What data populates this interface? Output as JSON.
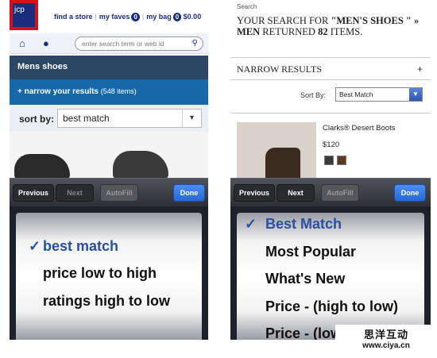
{
  "left": {
    "logo_text": "jcp",
    "links": {
      "find_store": "find a store",
      "faves_label": "my faves",
      "faves_count": "0",
      "bag_label": "my bag",
      "bag_count": "0",
      "bag_total": "$0.00"
    },
    "search": {
      "placeholder": "enter search term or web id"
    },
    "category_title": "Mens shoes",
    "narrow": {
      "label": "+ narrow your results",
      "count": "(548 items)"
    },
    "sort": {
      "label": "sort by:",
      "value": "best match"
    },
    "keyboard": {
      "previous": "Previous",
      "next": "Next",
      "autofill": "AutoFill",
      "done": "Done"
    },
    "picker_options": [
      "best match",
      "price low to high",
      "ratings high to low"
    ],
    "picker_selected_index": 0
  },
  "right": {
    "breadcrumb": "Search",
    "heading_prefix": "YOUR SEARCH FOR ",
    "heading_query": "\"MEN'S SHOES \" » MEN",
    "heading_mid": " RETURNED ",
    "heading_count": "82",
    "heading_suffix": " ITEMS.",
    "narrow_label": "NARROW RESULTS",
    "narrow_plus": "+",
    "sort": {
      "label": "Sort By:",
      "value": "Best Match"
    },
    "product": {
      "name": "Clarks® Desert Boots",
      "price": "$120",
      "swatch_colors": [
        "#3a3a3a",
        "#5b3a2a"
      ]
    },
    "keyboard": {
      "previous": "Previous",
      "next": "Next",
      "autofill": "AutoFill",
      "done": "Done"
    },
    "picker_options": [
      "Best Match",
      "Most Popular",
      "What's New",
      "Price - (high to low)",
      "Price - (low to high)"
    ],
    "picker_selected_index": 0
  },
  "watermark": {
    "line1": "思洋互动",
    "line2": "www.ciya.cn"
  },
  "colors": {
    "jcp_blue": "#1b2d7d",
    "jcp_red": "#d6101b",
    "ios_done_blue": "#2567d6",
    "selected_blue": "#2a4fa0"
  }
}
